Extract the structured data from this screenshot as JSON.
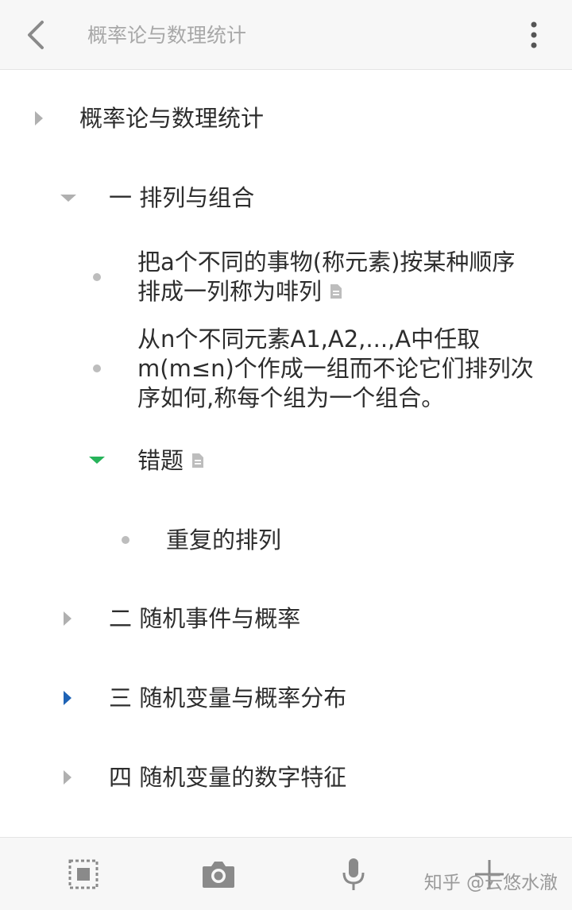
{
  "header": {
    "title": "概率论与数理统计"
  },
  "outline": {
    "root": "概率论与数理统计",
    "section1": {
      "title": "一 排列与组合",
      "item1_line1": "把a个不同的事物(称元素)按某种顺序",
      "item1_line2": "排成一列称为啡列",
      "item2_line1": "从n个不同元素A1,A2,...,A中任取",
      "item2_line2": "m(m≤n)个作成一组而不论它们排列次",
      "item2_line3": "序如何,称每个组为一个组合。",
      "wrong": {
        "title": "错题",
        "item1": "重复的排列"
      }
    },
    "section2": "二 随机事件与概率",
    "section3": "三 随机变量与概率分布",
    "section4": "四 随机变量的数字特征"
  },
  "watermark": "知乎 @云悠水澈",
  "colors": {
    "accent_green": "#27b35a",
    "accent_blue": "#1e63b5",
    "muted": "#b0b0b0"
  },
  "icons": {
    "back": "chevron-left-icon",
    "more": "more-vertical-icon",
    "note": "note-icon",
    "select": "select-frame-icon",
    "camera": "camera-icon",
    "mic": "microphone-icon",
    "add": "plus-icon"
  }
}
